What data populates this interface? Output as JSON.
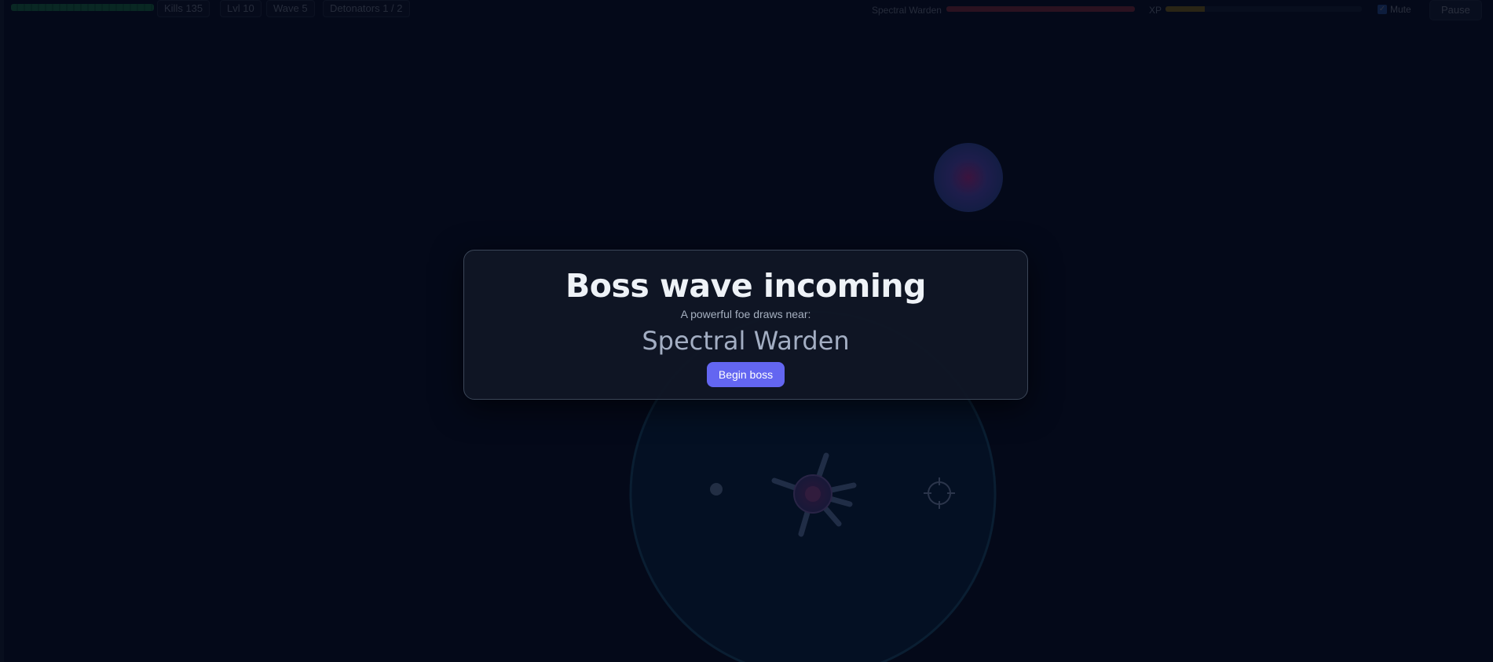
{
  "hud": {
    "kills": "Kills 135",
    "level": "Lvl 10",
    "wave": "Wave 5",
    "detonators": "Detonators 1 / 2",
    "player_health_fraction": 1.0,
    "boss_name": "Spectral Warden",
    "boss_health_fraction": 1.0,
    "xp_label": "XP",
    "xp_fraction": 0.2,
    "mute_label": "Mute",
    "mute_checked": true,
    "pause_label": "Pause"
  },
  "modal": {
    "title": "Boss wave incoming",
    "subtitle": "A powerful foe draws near:",
    "boss_name": "Spectral Warden",
    "begin_button_label": "Begin boss"
  },
  "colors": {
    "background": "#050a1b",
    "accent": "#6366f1",
    "player_health": "#22c55e",
    "boss_health": "#ef4444",
    "xp": "#eab308"
  }
}
